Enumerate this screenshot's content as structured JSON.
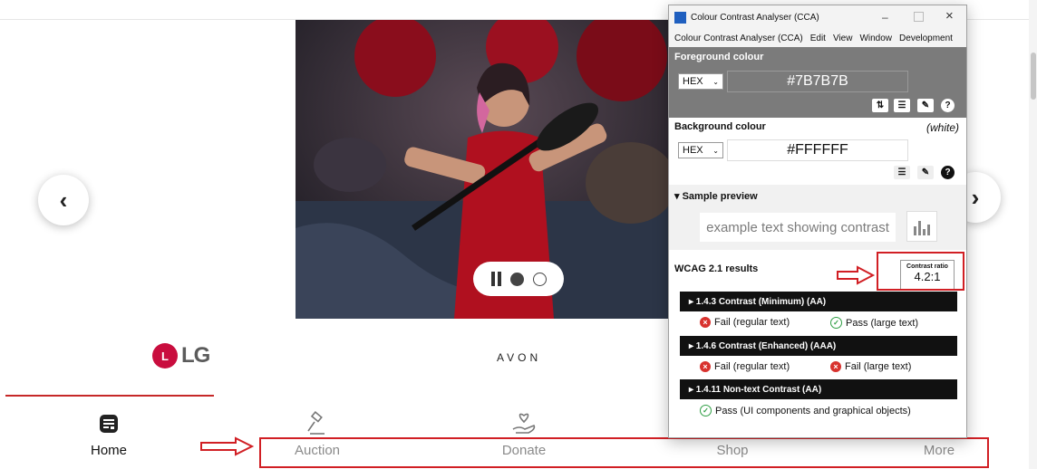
{
  "brands": {
    "lg_mark": "L",
    "lg": "LG",
    "avon": "AVON"
  },
  "bottom_nav": [
    {
      "label": "Home",
      "icon": "receipt-icon",
      "active": true
    },
    {
      "label": "Auction",
      "icon": "gavel-icon",
      "active": false
    },
    {
      "label": "Donate",
      "icon": "heart-hand-icon",
      "active": false
    },
    {
      "label": "Shop",
      "icon": "shop-icon",
      "active": false
    },
    {
      "label": "More",
      "icon": "more-icon",
      "active": false
    }
  ],
  "carousel": {
    "prev": "‹",
    "next": "›",
    "paused": true,
    "slide_count": 2,
    "current_slide": 1
  },
  "cca": {
    "title": "Colour Contrast Analyser (CCA)",
    "menu": [
      "Colour Contrast Analyser (CCA)",
      "Edit",
      "View",
      "Window",
      "Development"
    ],
    "foreground": {
      "heading": "Foreground colour",
      "format": "HEX",
      "value": "#7B7B7B"
    },
    "background": {
      "heading": "Background colour",
      "name": "(white)",
      "format": "HEX",
      "value": "#FFFFFF"
    },
    "preview": {
      "heading": "▾ Sample preview",
      "text": "example text showing contrast"
    },
    "results": {
      "heading": "WCAG 2.1 results",
      "ratio_label": "Contrast ratio",
      "ratio": "4.2:1",
      "criteria": [
        {
          "title": "▸ 1.4.3 Contrast (Minimum) (AA)",
          "results": [
            {
              "text": "Fail (regular text)",
              "pass": false
            },
            {
              "text": "Pass (large text)",
              "pass": true
            }
          ]
        },
        {
          "title": "▸ 1.4.6 Contrast (Enhanced) (AAA)",
          "results": [
            {
              "text": "Fail (regular text)",
              "pass": false
            },
            {
              "text": "Fail (large text)",
              "pass": false
            }
          ]
        },
        {
          "title": "▸ 1.4.11 Non-text Contrast (AA)",
          "results": [
            {
              "text": "Pass (UI components and graphical objects)",
              "pass": true
            }
          ]
        }
      ]
    }
  },
  "colors": {
    "accent_red": "#d11f24",
    "fg_sample": "#7B7B7B",
    "lg_red": "#c90d3e"
  }
}
